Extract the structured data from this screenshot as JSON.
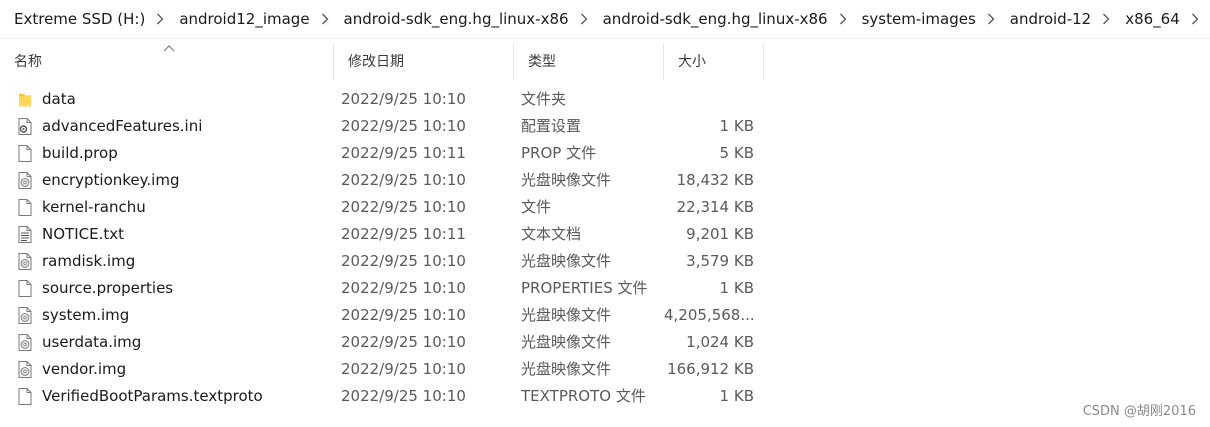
{
  "breadcrumb": [
    "Extreme SSD (H:)",
    "android12_image",
    "android-sdk_eng.hg_linux-x86",
    "android-sdk_eng.hg_linux-x86",
    "system-images",
    "android-12",
    "x86_64"
  ],
  "columns": {
    "name": "名称",
    "date": "修改日期",
    "type": "类型",
    "size": "大小"
  },
  "files": [
    {
      "name": "data",
      "date": "2022/9/25 10:10",
      "type": "文件夹",
      "size": "",
      "icon": "folder-icon"
    },
    {
      "name": "advancedFeatures.ini",
      "date": "2022/9/25 10:10",
      "type": "配置设置",
      "size": "1 KB",
      "icon": "settings-file-icon"
    },
    {
      "name": "build.prop",
      "date": "2022/9/25 10:11",
      "type": "PROP 文件",
      "size": "5 KB",
      "icon": "file-icon"
    },
    {
      "name": "encryptionkey.img",
      "date": "2022/9/25 10:10",
      "type": "光盘映像文件",
      "size": "18,432 KB",
      "icon": "disc-image-icon"
    },
    {
      "name": "kernel-ranchu",
      "date": "2022/9/25 10:10",
      "type": "文件",
      "size": "22,314 KB",
      "icon": "file-icon"
    },
    {
      "name": "NOTICE.txt",
      "date": "2022/9/25 10:11",
      "type": "文本文档",
      "size": "9,201 KB",
      "icon": "text-file-icon"
    },
    {
      "name": "ramdisk.img",
      "date": "2022/9/25 10:10",
      "type": "光盘映像文件",
      "size": "3,579 KB",
      "icon": "disc-image-icon"
    },
    {
      "name": "source.properties",
      "date": "2022/9/25 10:10",
      "type": "PROPERTIES 文件",
      "size": "1 KB",
      "icon": "file-icon"
    },
    {
      "name": "system.img",
      "date": "2022/9/25 10:10",
      "type": "光盘映像文件",
      "size": "4,205,568...",
      "icon": "disc-image-icon"
    },
    {
      "name": "userdata.img",
      "date": "2022/9/25 10:10",
      "type": "光盘映像文件",
      "size": "1,024 KB",
      "icon": "disc-image-icon"
    },
    {
      "name": "vendor.img",
      "date": "2022/9/25 10:10",
      "type": "光盘映像文件",
      "size": "166,912 KB",
      "icon": "disc-image-icon"
    },
    {
      "name": "VerifiedBootParams.textproto",
      "date": "2022/9/25 10:10",
      "type": "TEXTPROTO 文件",
      "size": "1 KB",
      "icon": "file-icon"
    }
  ],
  "watermark": "CSDN @胡刚2016"
}
